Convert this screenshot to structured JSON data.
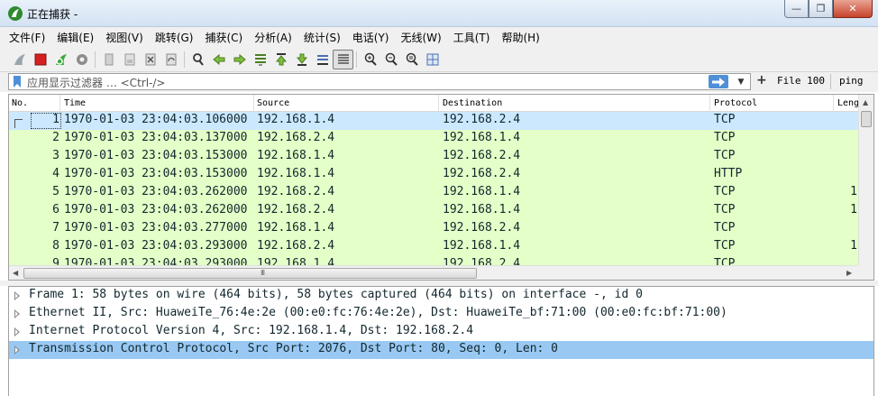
{
  "window": {
    "title": "正在捕获 -",
    "buttons": [
      "minimize",
      "restore",
      "close"
    ]
  },
  "menu": [
    "文件(F)",
    "编辑(E)",
    "视图(V)",
    "跳转(G)",
    "捕获(C)",
    "分析(A)",
    "统计(S)",
    "电话(Y)",
    "无线(W)",
    "工具(T)",
    "帮助(H)"
  ],
  "toolbar": {
    "icons": [
      "shark-fin-start-icon",
      "stop-square-icon",
      "restart-fin-icon",
      "options-gear-icon",
      "open-file-icon",
      "save-file-icon",
      "close-file-icon",
      "reload-icon",
      "find-packet-icon",
      "go-back-icon",
      "go-forward-icon",
      "go-to-packet-icon",
      "first-packet-icon",
      "last-packet-icon",
      "autoscroll-icon",
      "colorize-icon",
      "zoom-in-icon",
      "zoom-out-icon",
      "normal-size-icon",
      "resize-columns-icon"
    ]
  },
  "filter": {
    "placeholder": "应用显示过滤器 … <Ctrl-/>",
    "add_label": "+",
    "button1": "File 100",
    "button2": "ping"
  },
  "packet_list": {
    "columns": [
      "No.",
      "Time",
      "Source",
      "Destination",
      "Protocol",
      "Leng"
    ],
    "rows": [
      {
        "no": "1",
        "time": "1970-01-03 23:04:03.106000",
        "source": "192.168.1.4",
        "destination": "192.168.2.4",
        "protocol": "TCP",
        "length": ""
      },
      {
        "no": "2",
        "time": "1970-01-03 23:04:03.137000",
        "source": "192.168.2.4",
        "destination": "192.168.1.4",
        "protocol": "TCP",
        "length": ""
      },
      {
        "no": "3",
        "time": "1970-01-03 23:04:03.153000",
        "source": "192.168.1.4",
        "destination": "192.168.2.4",
        "protocol": "TCP",
        "length": ""
      },
      {
        "no": "4",
        "time": "1970-01-03 23:04:03.153000",
        "source": "192.168.1.4",
        "destination": "192.168.2.4",
        "protocol": "HTTP",
        "length": ""
      },
      {
        "no": "5",
        "time": "1970-01-03 23:04:03.262000",
        "source": "192.168.2.4",
        "destination": "192.168.1.4",
        "protocol": "TCP",
        "length": "1"
      },
      {
        "no": "6",
        "time": "1970-01-03 23:04:03.262000",
        "source": "192.168.2.4",
        "destination": "192.168.1.4",
        "protocol": "TCP",
        "length": "1"
      },
      {
        "no": "7",
        "time": "1970-01-03 23:04:03.277000",
        "source": "192.168.1.4",
        "destination": "192.168.2.4",
        "protocol": "TCP",
        "length": ""
      },
      {
        "no": "8",
        "time": "1970-01-03 23:04:03.293000",
        "source": "192.168.2.4",
        "destination": "192.168.1.4",
        "protocol": "TCP",
        "length": "1"
      },
      {
        "no": "9",
        "time": "1970-01-03 23:04:03.293000",
        "source": "192.168.1.4",
        "destination": "192.168.2.4",
        "protocol": "TCP",
        "length": ""
      }
    ],
    "selected_row": "1",
    "hscroll_grip": "III"
  },
  "details": [
    "Frame 1: 58 bytes on wire (464 bits), 58 bytes captured (464 bits) on interface -, id 0",
    "Ethernet II, Src: HuaweiTe_76:4e:2e (00:e0:fc:76:4e:2e), Dst: HuaweiTe_bf:71:00 (00:e0:fc:bf:71:00)",
    "Internet Protocol Version 4, Src: 192.168.1.4, Dst: 192.168.2.4",
    "Transmission Control Protocol, Src Port: 2076, Dst Port: 80, Seq: 0, Len: 0"
  ],
  "colors": {
    "row_green": "#e4ffc7",
    "row_selected": "#cce8ff",
    "detail_selected": "#99c9f3",
    "apply_button": "#4f8fd8"
  }
}
